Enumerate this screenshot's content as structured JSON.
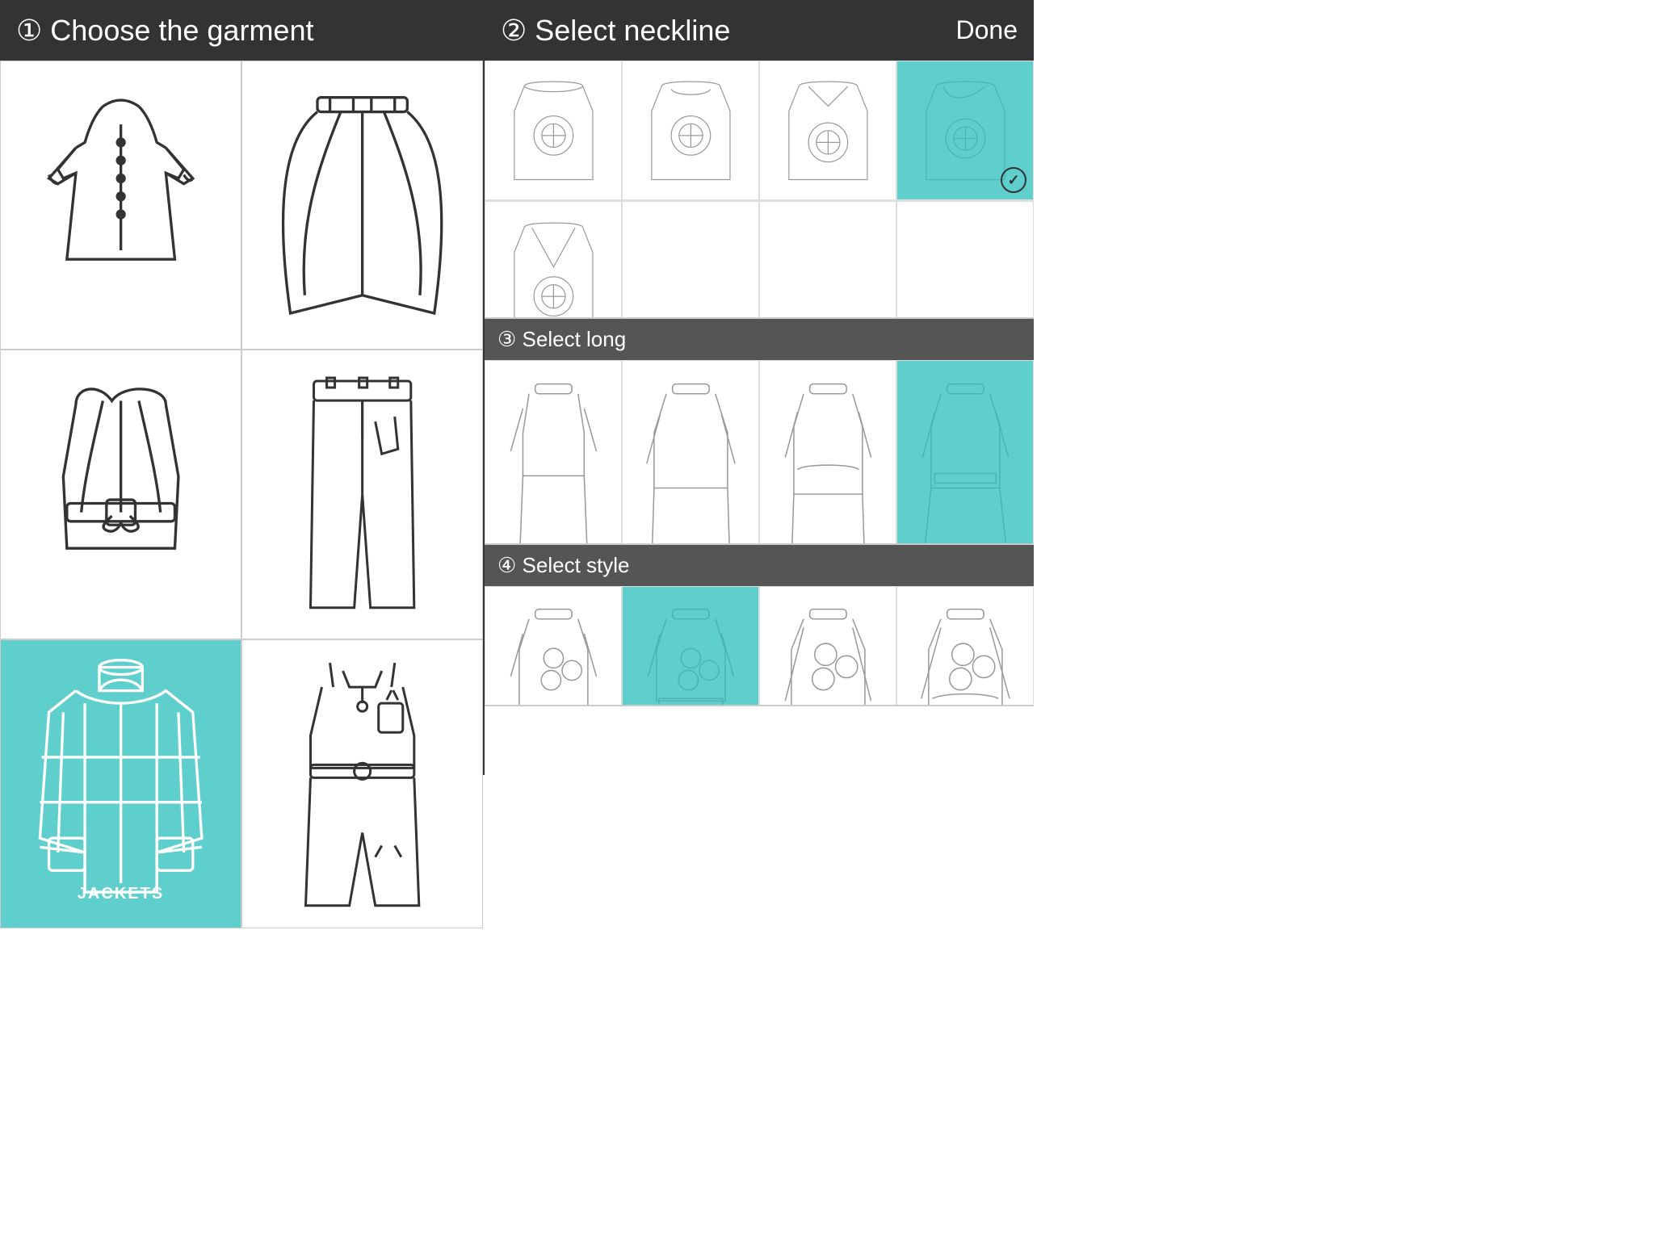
{
  "left": {
    "header": "① Choose the garment",
    "garments": [
      {
        "id": "blouse",
        "label": "BLOUSE",
        "selected": false
      },
      {
        "id": "cape",
        "label": "CAPE",
        "selected": false
      },
      {
        "id": "corset",
        "label": "CORSET",
        "selected": false
      },
      {
        "id": "trousers",
        "label": "TROUSERS",
        "selected": false
      },
      {
        "id": "jacket",
        "label": "JACKETS",
        "selected": true
      },
      {
        "id": "jumpsuit",
        "label": "JUMPSUIT",
        "selected": false
      }
    ]
  },
  "right": {
    "header": "② Select neckline",
    "done_label": "Done",
    "sections": [
      {
        "id": "neckline",
        "label": "② Select neckline",
        "options": [
          {
            "id": "round",
            "selected": false
          },
          {
            "id": "crew",
            "selected": false
          },
          {
            "id": "v-neck",
            "selected": false
          },
          {
            "id": "cowl",
            "selected": true
          },
          {
            "id": "deep-v",
            "selected": false
          }
        ]
      },
      {
        "id": "long",
        "label": "③ Select long",
        "options": [
          {
            "id": "long1",
            "selected": false
          },
          {
            "id": "long2",
            "selected": false
          },
          {
            "id": "long3",
            "selected": false
          },
          {
            "id": "long4",
            "selected": true
          },
          {
            "id": "long5",
            "selected": false
          }
        ]
      },
      {
        "id": "style",
        "label": "④ Select style",
        "options": [
          {
            "id": "style1",
            "selected": false
          },
          {
            "id": "style2",
            "selected": true
          },
          {
            "id": "style3",
            "selected": false
          },
          {
            "id": "style4",
            "selected": false
          }
        ]
      }
    ]
  }
}
